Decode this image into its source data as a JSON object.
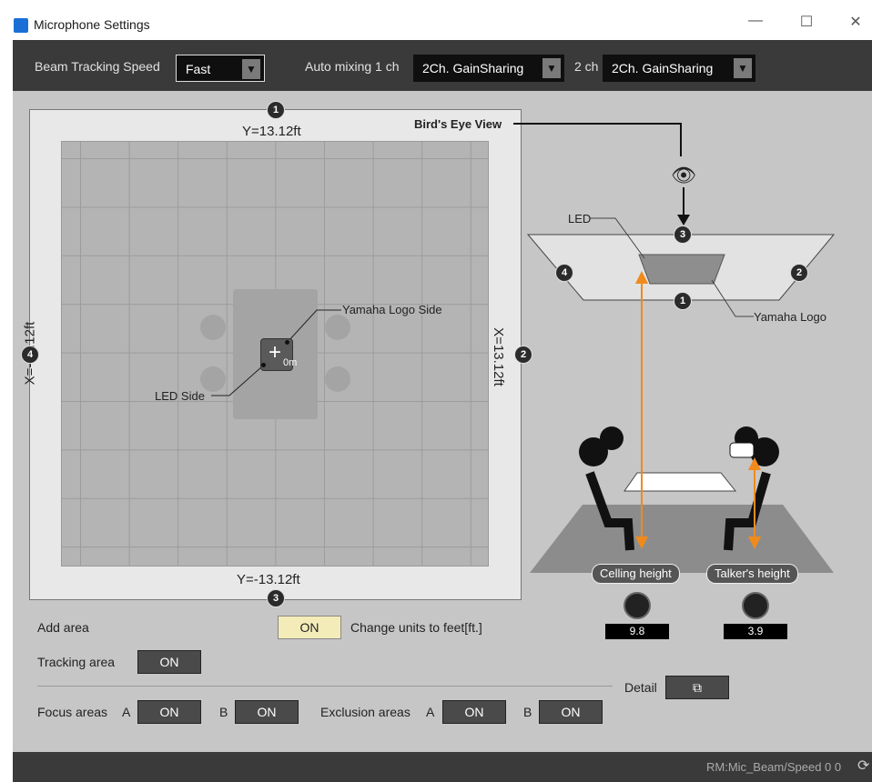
{
  "window": {
    "title": "Microphone Settings",
    "minimize_icon": "—",
    "maximize_icon": "☐",
    "close_icon": "✕"
  },
  "toolbar": {
    "beam_label": "Beam Tracking Speed",
    "beam_value": "Fast",
    "auto_label": "Auto mixing 1 ch",
    "auto_1ch_value": "2Ch. GainSharing",
    "ch2_label": "2 ch",
    "auto_2ch_value": "2Ch. GainSharing"
  },
  "plan": {
    "top_label": "Y=13.12ft",
    "bottom_label": "Y=-13.12ft",
    "left_label": "X=-13.12ft",
    "right_label": "X=13.12ft",
    "badge_top": "1",
    "badge_right": "2",
    "badge_bottom": "3",
    "badge_left": "4",
    "logo_side_label": "Yamaha Logo Side",
    "led_side_label": "LED Side",
    "origin_label": "0m"
  },
  "diagram": {
    "birds_eye_label": "Bird's Eye View",
    "led_label": "LED",
    "logo_label": "Yamaha Logo",
    "badge_top": "3",
    "badge_right": "2",
    "badge_bottom": "1",
    "badge_left": "4",
    "ceiling_label": "Celling height",
    "ceiling_value": "9.8",
    "talker_label": "Talker's height",
    "talker_value": "3.9"
  },
  "controls": {
    "add_area_label": "Add area",
    "units_button": "ON",
    "units_label": "Change units to feet[ft.]",
    "tracking_label": "Tracking area",
    "tracking_button": "ON",
    "detail_label": "Detail",
    "detail_icon": "⧉",
    "focus_label": "Focus areas",
    "focus_a_label": "A",
    "focus_a_button": "ON",
    "focus_b_label": "B",
    "focus_b_button": "ON",
    "excl_label": "Exclusion areas",
    "excl_a_label": "A",
    "excl_a_button": "ON",
    "excl_b_label": "B",
    "excl_b_button": "ON"
  },
  "status": {
    "text": "RM:Mic_Beam/Speed 0 0",
    "refresh_icon": "⟳"
  },
  "colors": {
    "accent": "#f08a1c",
    "background": "#c6c6c6",
    "toolbar": "#3a3a3a"
  }
}
